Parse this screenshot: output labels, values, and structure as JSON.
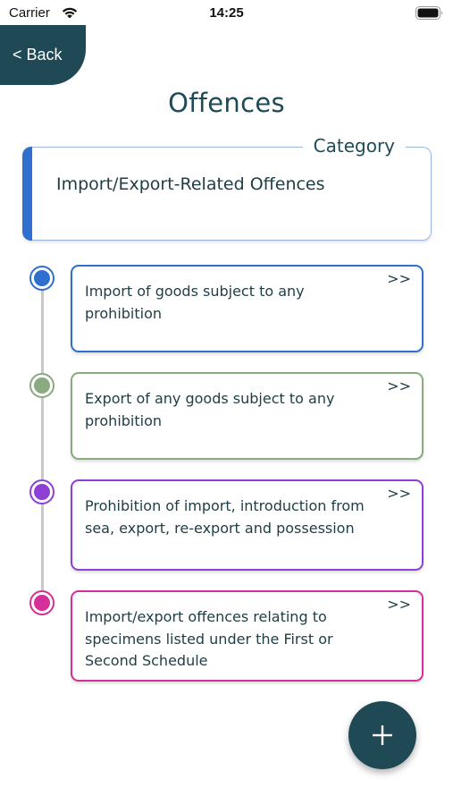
{
  "status_bar": {
    "carrier": "Carrier",
    "time": "14:25",
    "icons": [
      "wifi-icon",
      "battery-icon"
    ]
  },
  "nav": {
    "back_label": "< Back"
  },
  "page": {
    "title": "Offences"
  },
  "category": {
    "legend": "Category",
    "value": "Import/Export-Related Offences",
    "accent_color": "#2f6fcf"
  },
  "offences": [
    {
      "text": "Import of goods subject to any prohibition",
      "chevron": ">>",
      "color": "#2f6fcf"
    },
    {
      "text": "Export of any goods subject to any prohibition",
      "chevron": ">>",
      "color": "#8aaa80"
    },
    {
      "text": "Prohibition of import, introduction from sea, export, re-export and possession",
      "chevron": ">>",
      "color": "#8d3fd6"
    },
    {
      "text": "Import/export offences relating to specimens listed under the First or Second Schedule",
      "chevron": ">>",
      "color": "#d42f9a"
    }
  ],
  "fab": {
    "icon": "plus-icon",
    "color": "#1f4a55"
  }
}
